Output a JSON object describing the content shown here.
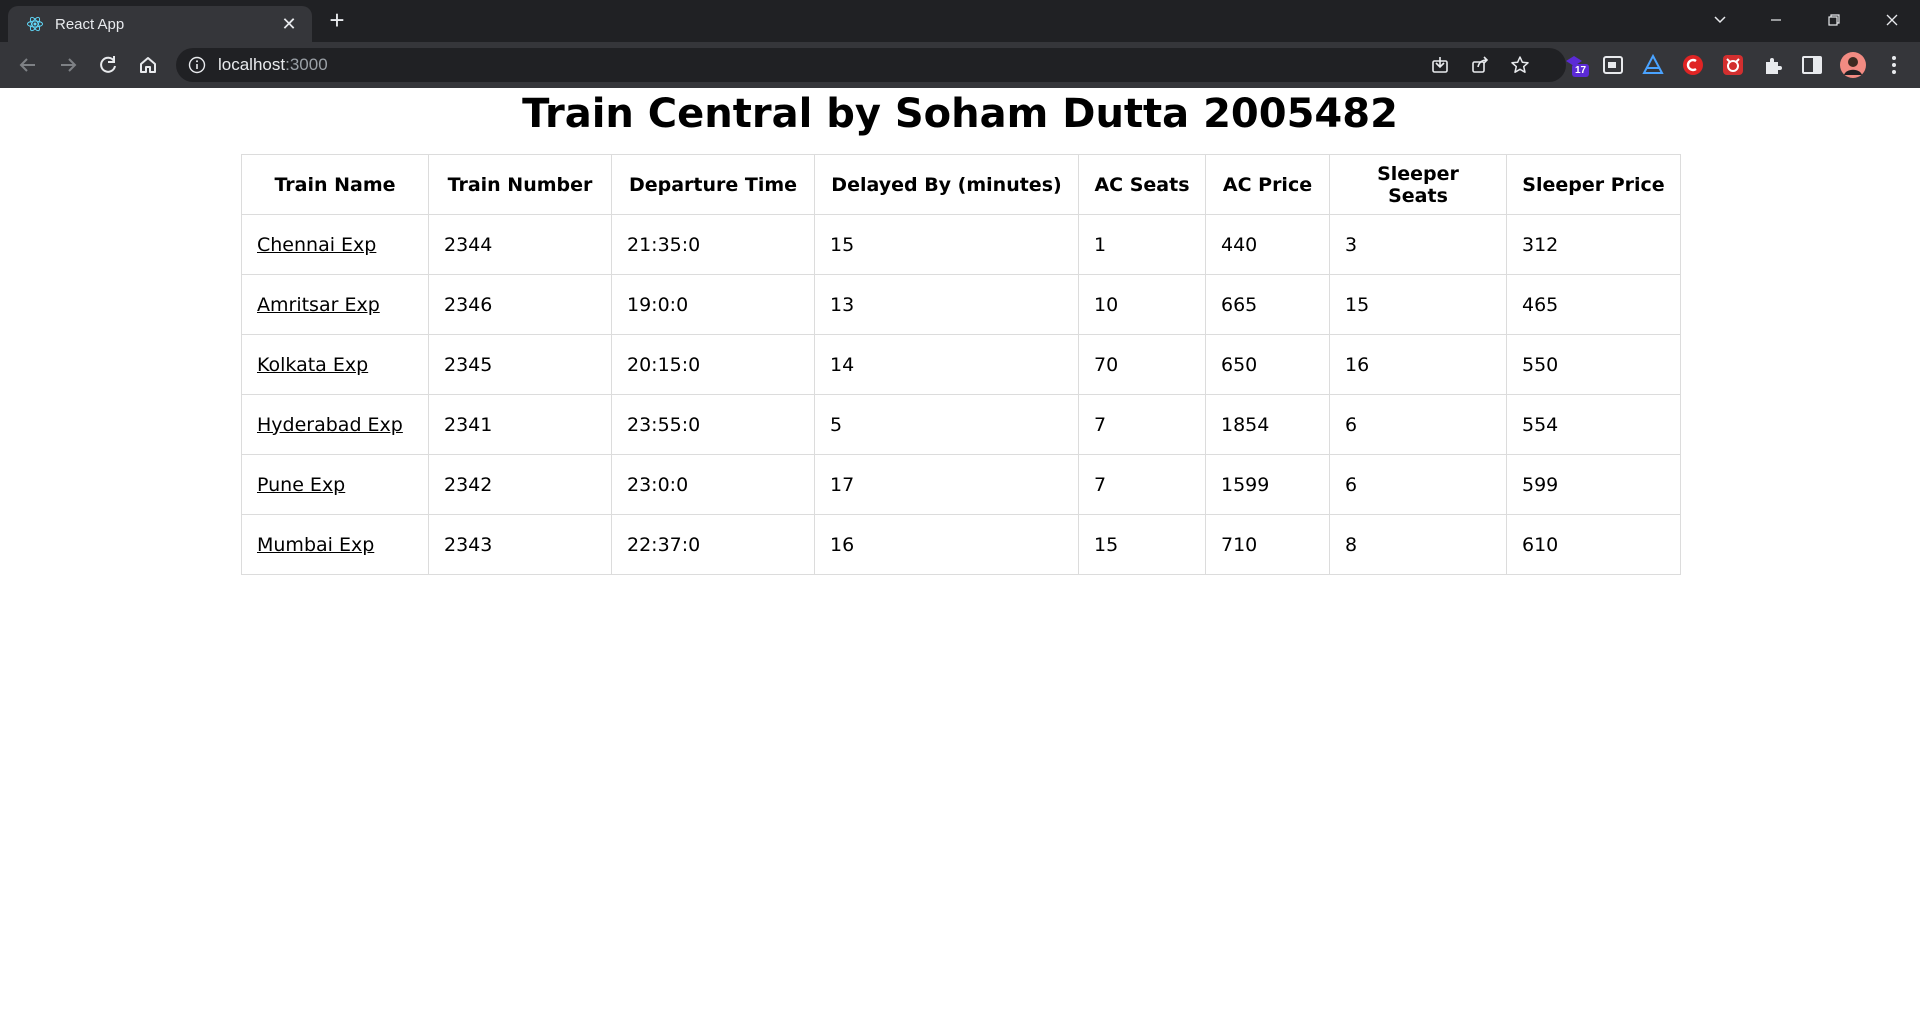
{
  "browser": {
    "tab_title": "React App",
    "url_host": "localhost",
    "url_port": ":3000",
    "extension_badge": "17"
  },
  "page": {
    "title": "Train Central by Soham Dutta 2005482"
  },
  "table": {
    "headers": [
      "Train Name",
      "Train Number",
      "Departure Time",
      "Delayed By (minutes)",
      "AC Seats",
      "AC Price",
      "Sleeper Seats",
      "Sleeper Price"
    ],
    "rows": [
      [
        "Chennai Exp",
        "2344",
        "21:35:0",
        "15",
        "1",
        "440",
        "3",
        "312"
      ],
      [
        "Amritsar Exp",
        "2346",
        "19:0:0",
        "13",
        "10",
        "665",
        "15",
        "465"
      ],
      [
        "Kolkata Exp",
        "2345",
        "20:15:0",
        "14",
        "70",
        "650",
        "16",
        "550"
      ],
      [
        "Hyderabad Exp",
        "2341",
        "23:55:0",
        "5",
        "7",
        "1854",
        "6",
        "554"
      ],
      [
        "Pune Exp",
        "2342",
        "23:0:0",
        "17",
        "7",
        "1599",
        "6",
        "599"
      ],
      [
        "Mumbai Exp",
        "2343",
        "22:37:0",
        "16",
        "15",
        "710",
        "8",
        "610"
      ]
    ]
  },
  "icons": {
    "tab_favicon": "react-icon",
    "close": "close-icon",
    "new_tab": "plus-icon",
    "back": "back-arrow-icon",
    "forward": "forward-arrow-icon",
    "reload": "reload-icon",
    "home": "home-icon",
    "site_info": "info-icon",
    "install": "install-icon",
    "share": "share-icon",
    "bookmark": "star-icon",
    "extensions": "puzzle-icon",
    "side_panel": "side-panel-icon",
    "profile": "avatar-icon",
    "menu": "kebab-menu-icon"
  },
  "colors": {
    "chrome_dark": "#202124",
    "chrome_toolbar": "#35363a",
    "table_border": "#dcdcdc",
    "text": "#000000"
  }
}
